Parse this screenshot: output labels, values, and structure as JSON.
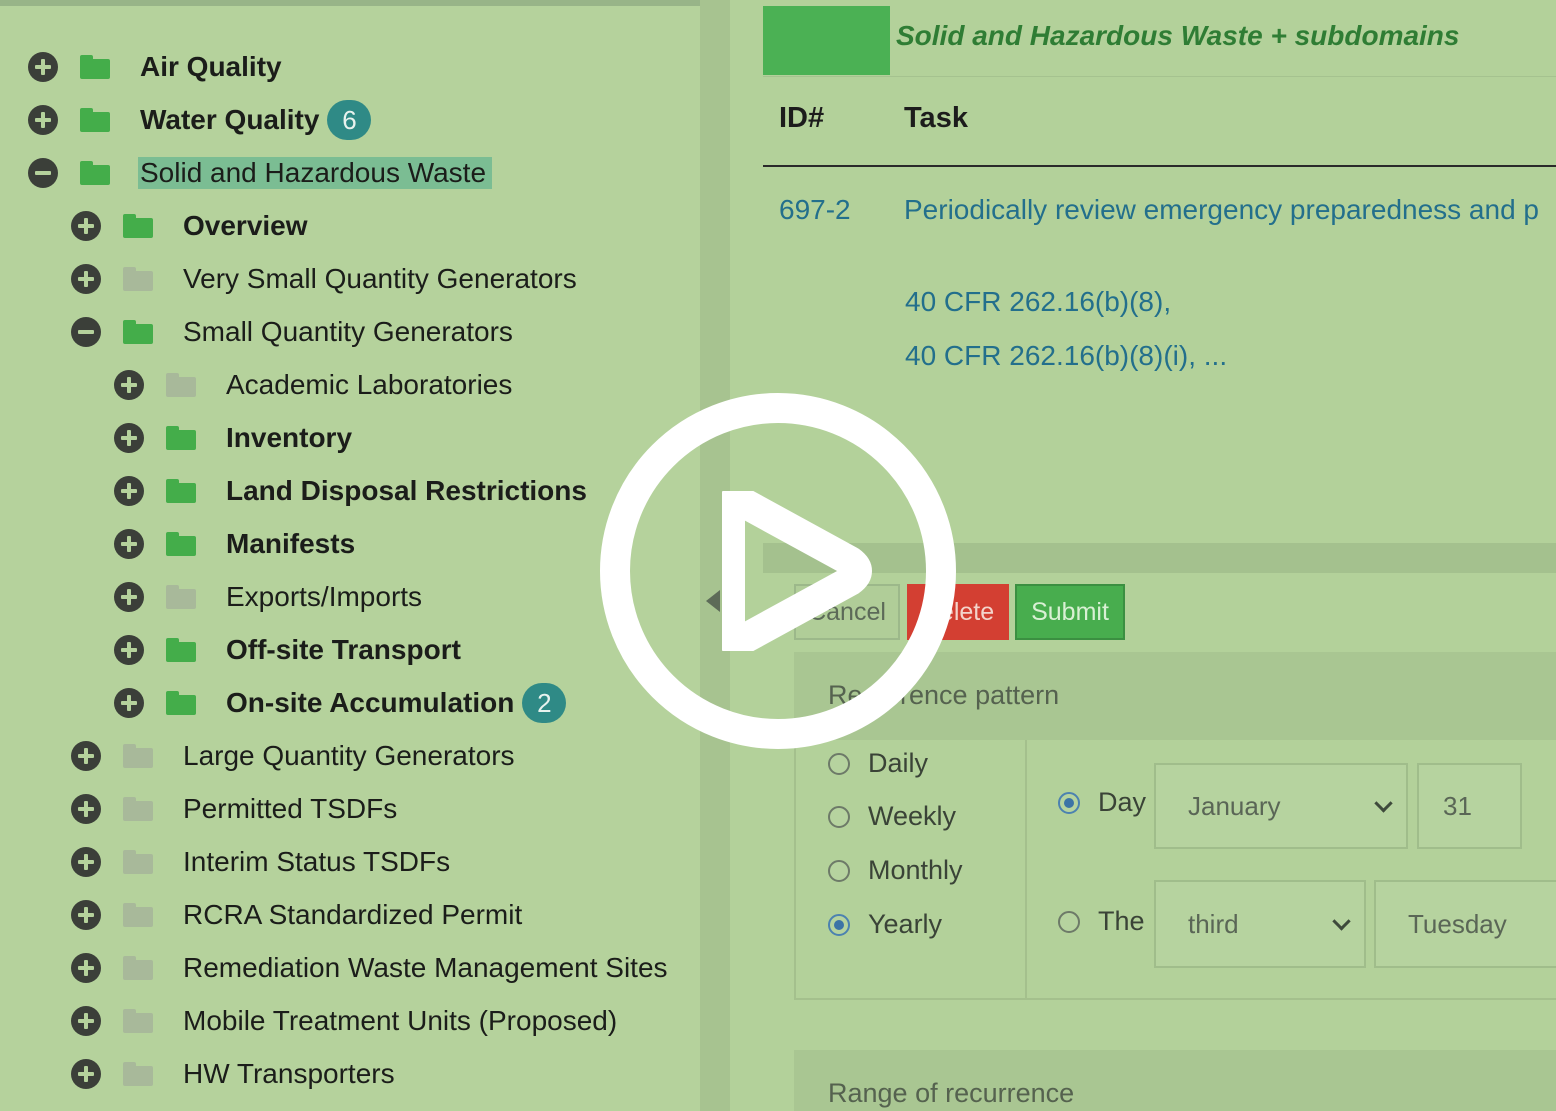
{
  "tree": {
    "items": [
      {
        "label": "Air Quality",
        "level": 0,
        "expanded": false,
        "folder": "green",
        "bold": true
      },
      {
        "label": "Water Quality",
        "level": 0,
        "expanded": false,
        "folder": "green",
        "bold": true,
        "badge": "6"
      },
      {
        "label": "Solid and Hazardous Waste",
        "level": 0,
        "expanded": true,
        "folder": "green",
        "bold": false,
        "selected": true
      },
      {
        "label": "Overview",
        "level": 1,
        "expanded": false,
        "folder": "green",
        "bold": true
      },
      {
        "label": "Very Small Quantity Generators",
        "level": 1,
        "expanded": false,
        "folder": "grey",
        "bold": false
      },
      {
        "label": "Small Quantity Generators",
        "level": 1,
        "expanded": true,
        "folder": "green",
        "bold": false
      },
      {
        "label": "Academic Laboratories",
        "level": 2,
        "expanded": false,
        "folder": "grey",
        "bold": false
      },
      {
        "label": "Inventory",
        "level": 2,
        "expanded": false,
        "folder": "green",
        "bold": true
      },
      {
        "label": "Land Disposal Restrictions",
        "level": 2,
        "expanded": false,
        "folder": "green",
        "bold": true
      },
      {
        "label": "Manifests",
        "level": 2,
        "expanded": false,
        "folder": "green",
        "bold": true
      },
      {
        "label": "Exports/Imports",
        "level": 2,
        "expanded": false,
        "folder": "grey",
        "bold": false
      },
      {
        "label": "Off-site Transport",
        "level": 2,
        "expanded": false,
        "folder": "green",
        "bold": true
      },
      {
        "label": "On-site Accumulation",
        "level": 2,
        "expanded": false,
        "folder": "green",
        "bold": true,
        "badge": "2"
      },
      {
        "label": "Large Quantity Generators",
        "level": 1,
        "expanded": false,
        "folder": "grey",
        "bold": false
      },
      {
        "label": "Permitted TSDFs",
        "level": 1,
        "expanded": false,
        "folder": "grey",
        "bold": false
      },
      {
        "label": "Interim Status TSDFs",
        "level": 1,
        "expanded": false,
        "folder": "grey",
        "bold": false
      },
      {
        "label": "RCRA Standardized Permit",
        "level": 1,
        "expanded": false,
        "folder": "grey",
        "bold": false
      },
      {
        "label": "Remediation Waste Management Sites",
        "level": 1,
        "expanded": false,
        "folder": "grey",
        "bold": false
      },
      {
        "label": "Mobile Treatment Units (Proposed)",
        "level": 1,
        "expanded": false,
        "folder": "grey",
        "bold": false
      },
      {
        "label": "HW Transporters",
        "level": 1,
        "expanded": false,
        "folder": "grey",
        "bold": false
      }
    ]
  },
  "panel": {
    "title": "Solid and Hazardous Waste + subdomains",
    "columns": {
      "id": "ID#",
      "task": "Task"
    },
    "row": {
      "id": "697-2",
      "task": "Periodically review emergency preparedness and p",
      "citations": [
        "40 CFR 262.16(b)(8),",
        "40 CFR 262.16(b)(8)(i), ..."
      ]
    }
  },
  "buttons": {
    "cancel": "Cancel",
    "delete": "Delete",
    "submit": "Submit"
  },
  "recurrence": {
    "title": "Recurrence pattern",
    "options": [
      "Daily",
      "Weekly",
      "Monthly",
      "Yearly"
    ],
    "selected_option": "Yearly",
    "day_label": "Day",
    "month_value": "January",
    "day_value": "31",
    "the_label": "The",
    "ordinal_value": "third",
    "weekday_value": "Tuesday",
    "selected_yearly_mode": "Day"
  },
  "range": {
    "title": "Range of recurrence"
  },
  "colors": {
    "background": "#b3d19a",
    "brand_green": "#44ad4a",
    "link_blue": "#236f8c",
    "badge_teal": "#2f8a86",
    "delete_red": "#d33f32"
  },
  "icons": {
    "expand": "plus-circle-icon",
    "collapse": "minus-circle-icon",
    "folder": "folder-icon",
    "play": "play-icon",
    "chevron": "chevron-down-icon",
    "splitter": "caret-left-icon"
  }
}
